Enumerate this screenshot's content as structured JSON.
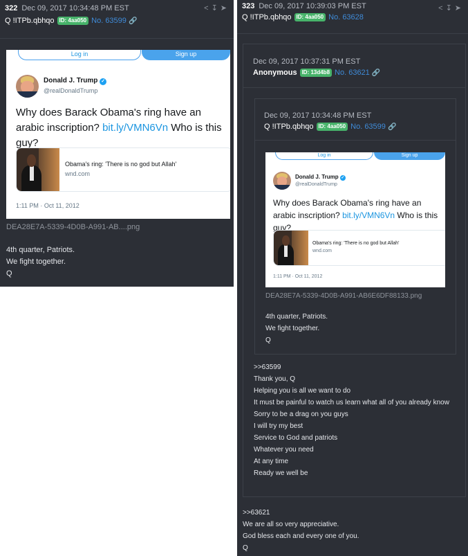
{
  "post_left": {
    "number": "322",
    "date": "Dec 09, 2017 10:34:48 PM EST",
    "tripcode": "Q !ITPb.qbhqo",
    "id_badge": "ID: 4aa050",
    "post_no": "No. 63599",
    "tweet": {
      "login": "Log in",
      "signup": "Sign up",
      "name": "Donald J. Trump",
      "handle": "@realDonaldTrump",
      "text_before": "Why does Barack Obama's ring have an arabic inscription? ",
      "text_link": "bit.ly/VMN6Vn",
      "text_after": " Who is this guy?",
      "card_title": "Obama's ring: 'There is no god but Allah'",
      "card_domain": "wnd.com",
      "time": "1:11 PM · Oct 11, 2012"
    },
    "filename": "DEA28E7A-5339-4D0B-A991-AB....png",
    "lines": [
      "4th quarter, Patriots.",
      "We fight together.",
      "Q"
    ]
  },
  "post_right": {
    "number": "323",
    "date": "Dec 09, 2017 10:39:03 PM EST",
    "tripcode": "Q !ITPb.qbhqo",
    "id_badge": "ID: 4aa050",
    "post_no": "No. 63628",
    "quoted": {
      "date": "Dec 09, 2017 10:37:31 PM EST",
      "author": "Anonymous",
      "id_badge": "ID: 13d4b8",
      "post_no": "No. 63621",
      "inner": {
        "date": "Dec 09, 2017 10:34:48 PM EST",
        "tripcode": "Q !ITPb.qbhqo",
        "id_badge": "ID: 4aa050",
        "post_no": "No. 63599",
        "filename": "DEA28E7A-5339-4D0B-A991-AB6E6DF88133.png",
        "lines": [
          "4th quarter, Patriots.",
          "We fight together.",
          "Q"
        ]
      },
      "lines": [
        ">>63599",
        "Thank you, Q",
        "Helping you is all we want to do",
        "It must be painful to watch us learn what all of you already know",
        "Sorry to be a drag on you guys",
        "I will try my best",
        "Service to God and patriots",
        "Whatever you need",
        "At any time",
        "Ready we well be"
      ]
    },
    "lines": [
      ">>63621",
      "We are all so very appreciative.",
      "God bless each and every one of you.",
      "Q"
    ]
  },
  "icons": [
    "share-icon",
    "download-icon",
    "reply-icon",
    "link-chain-icon",
    "verified-badge-icon"
  ]
}
